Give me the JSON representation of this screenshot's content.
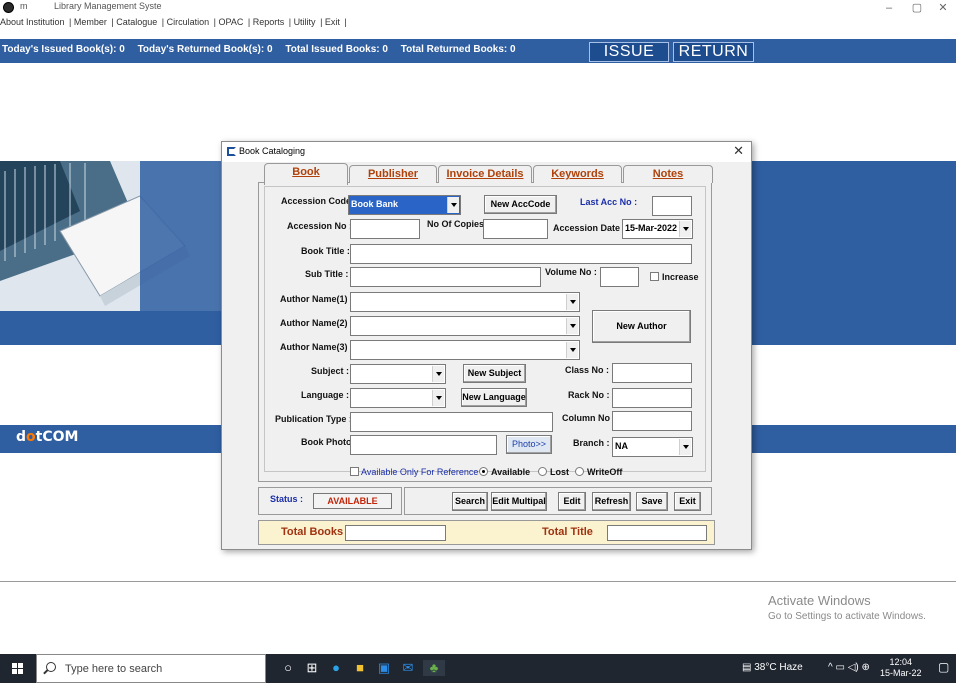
{
  "window": {
    "title_prefix": "m",
    "title": "Library Management Syste",
    "minimize": "–",
    "maximize": "▢",
    "close": "✕"
  },
  "menu": [
    "About Institution",
    "Member",
    "Catalogue",
    "Circulation",
    "OPAC",
    "Reports",
    "Utility",
    "Exit"
  ],
  "stats": {
    "todays_issued": "Today's Issued Book(s): 0",
    "todays_returned": "Today's Returned Book(s): 0",
    "total_issued": "Total Issued Books: 0",
    "total_returned": "Total Returned Books: 0"
  },
  "actions": {
    "issue": "ISSUE",
    "return": "RETURN"
  },
  "brand": {
    "prefix": "d",
    "mark": "o",
    "suffix": "tCOM"
  },
  "dialog": {
    "title": "Book Cataloging",
    "close": "✕",
    "tabs": [
      {
        "label": "Book",
        "active": true
      },
      {
        "label": "Publisher",
        "active": false
      },
      {
        "label": "Invoice Details",
        "active": false
      },
      {
        "label": "Keywords",
        "active": false
      },
      {
        "label": "Notes",
        "active": false
      }
    ],
    "form": {
      "accession_code_label": "Accession Code:",
      "accession_code_value": "Book Bank",
      "new_acccode_button": "New AccCode",
      "last_acc_no_label": "Last Acc No :",
      "last_acc_no_value": "",
      "accession_no_label": "Accession No :",
      "accession_no_value": "",
      "no_of_copies_label": "No Of Copies :",
      "no_of_copies_value": "",
      "accession_date_label": "Accession Date :",
      "accession_date_value": "15-Mar-2022",
      "book_title_label": "Book Title :",
      "book_title_value": "",
      "sub_title_label": "Sub Title :",
      "sub_title_value": "",
      "volume_no_label": "Volume No :",
      "volume_no_value": "",
      "increase_label": "Increase",
      "author1_label": "Author Name(1) :",
      "author2_label": "Author Name(2) :",
      "author3_label": "Author Name(3) :",
      "new_author_button": "New Author",
      "subject_label": "Subject :",
      "new_subject_button": "New Subject",
      "class_no_label": "Class No  :",
      "language_label": "Language :",
      "new_language_button": "New Language",
      "rack_no_label": "Rack No :",
      "publication_type_label": "Publication Type :",
      "column_no_label": "Column No :",
      "book_photo_label": "Book Photo",
      "photo_button": "Photo>>",
      "branch_label": "Branch :",
      "branch_value": "NA",
      "reference_label": "Available Only For Reference",
      "available_label": "Available",
      "lost_label": "Lost",
      "writeoff_label": "WriteOff"
    },
    "status_label": "Status :",
    "status_value": "AVAILABLE",
    "buttons": [
      "Search",
      "Edit Multipal",
      "Edit",
      "Refresh",
      "Save",
      "Exit"
    ],
    "total_books_label": "Total Books",
    "total_title_label": "Total Title"
  },
  "activation": {
    "line1": "Activate Windows",
    "line2": "Go to Settings to activate Windows."
  },
  "taskbar": {
    "search_placeholder": "Type here to search",
    "weather": "38°C  Haze",
    "time": "12:04",
    "date": "15-Mar-22"
  }
}
